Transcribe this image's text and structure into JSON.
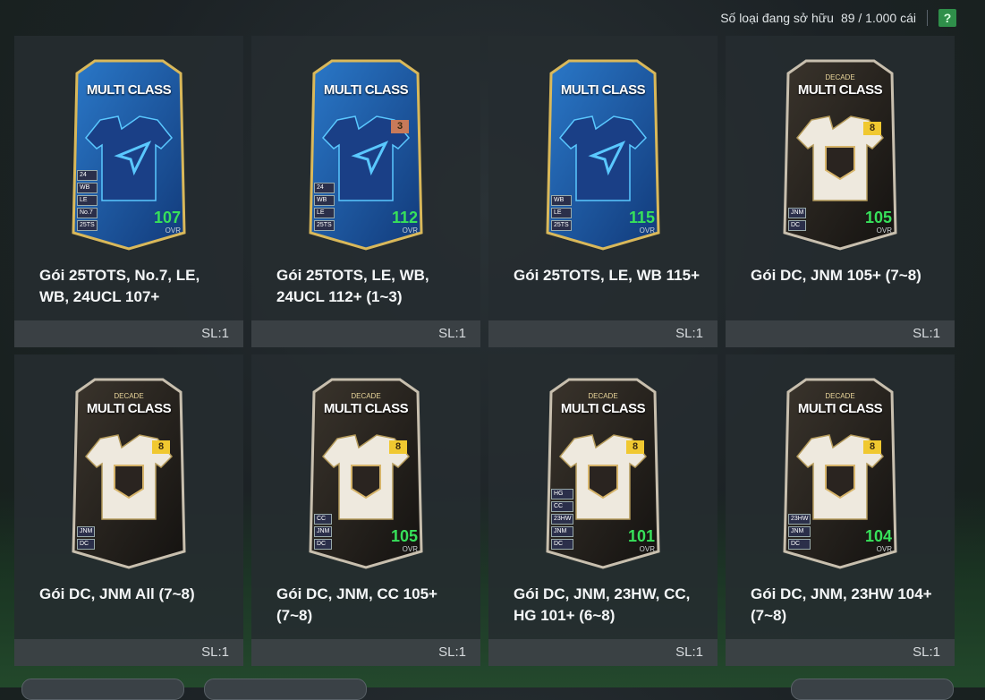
{
  "header": {
    "owned_label": "Số loại đang sở hữu",
    "owned_count": "89 / 1.000 cái",
    "help_label": "?"
  },
  "colors": {
    "tots_card": "#1f5aa8",
    "dc_card": "#2a2622",
    "ovr_green": "#37e05a",
    "help_button": "#2f8f4a"
  },
  "packs": [
    {
      "name": "Gói 25TOTS, No.7, LE, WB, 24UCL 107+",
      "qty": "SL:1",
      "card": {
        "style": "tots",
        "title": "MULTI CLASS",
        "subtitle": "",
        "ovr": "107",
        "ovr_label": "OVR",
        "badge": "",
        "badges": [
          "24",
          "WB",
          "LE",
          "No.7",
          "25TS"
        ]
      }
    },
    {
      "name": "Gói 25TOTS, LE, WB, 24UCL 112+ (1~3)",
      "qty": "SL:1",
      "card": {
        "style": "tots",
        "title": "MULTI CLASS",
        "subtitle": "",
        "ovr": "112",
        "ovr_label": "OVR",
        "badge": "3",
        "badges": [
          "24",
          "WB",
          "LE",
          "25TS"
        ]
      }
    },
    {
      "name": "Gói 25TOTS, LE, WB 115+",
      "qty": "SL:1",
      "card": {
        "style": "tots",
        "title": "MULTI CLASS",
        "subtitle": "",
        "ovr": "115",
        "ovr_label": "OVR",
        "badge": "",
        "badges": [
          "WB",
          "LE",
          "25TS"
        ]
      }
    },
    {
      "name": "Gói DC, JNM 105+ (7~8)",
      "qty": "SL:1",
      "card": {
        "style": "dc",
        "title": "MULTI CLASS",
        "subtitle": "DECADE",
        "ovr": "105",
        "ovr_label": "OVR",
        "badge": "8",
        "badges": [
          "JNM",
          "DC"
        ]
      }
    },
    {
      "name": "Gói DC, JNM All (7~8)",
      "qty": "SL:1",
      "card": {
        "style": "dc",
        "title": "MULTI CLASS",
        "subtitle": "DECADE",
        "ovr": "",
        "ovr_label": "",
        "badge": "8",
        "badges": [
          "JNM",
          "DC"
        ]
      }
    },
    {
      "name": "Gói DC, JNM, CC 105+ (7~8)",
      "qty": "SL:1",
      "card": {
        "style": "dc",
        "title": "MULTI CLASS",
        "subtitle": "DECADE",
        "ovr": "105",
        "ovr_label": "OVR",
        "badge": "8",
        "badges": [
          "CC",
          "JNM",
          "DC"
        ]
      }
    },
    {
      "name": "Gói DC, JNM, 23HW, CC, HG 101+ (6~8)",
      "qty": "SL:1",
      "card": {
        "style": "dc",
        "title": "MULTI CLASS",
        "subtitle": "DECADE",
        "ovr": "101",
        "ovr_label": "OVR",
        "badge": "8",
        "badges": [
          "HG",
          "CC",
          "23HW",
          "JNM",
          "DC"
        ]
      }
    },
    {
      "name": "Gói DC, JNM, 23HW 104+ (7~8)",
      "qty": "SL:1",
      "card": {
        "style": "dc",
        "title": "MULTI CLASS",
        "subtitle": "DECADE",
        "ovr": "104",
        "ovr_label": "OVR",
        "badge": "8",
        "badges": [
          "23HW",
          "JNM",
          "DC"
        ]
      }
    }
  ]
}
